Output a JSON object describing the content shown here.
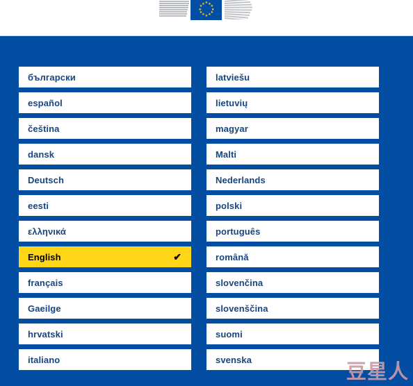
{
  "header": {
    "logo_name": "european-commission-logo",
    "flag_alt": "European Union flag",
    "star_glyph": "★"
  },
  "colors": {
    "panel_blue": "#034ea2",
    "selected_yellow": "#ffd617",
    "item_background": "#ffffff",
    "item_text": "#17457f",
    "selected_text": "#000000",
    "watermark": "#c89ba6"
  },
  "language_selector": {
    "selected_language": "English",
    "check_glyph": "✔",
    "columns": [
      {
        "items": [
          {
            "label": "български",
            "selected": false
          },
          {
            "label": "español",
            "selected": false
          },
          {
            "label": "čeština",
            "selected": false
          },
          {
            "label": "dansk",
            "selected": false
          },
          {
            "label": "Deutsch",
            "selected": false
          },
          {
            "label": "eesti",
            "selected": false
          },
          {
            "label": "ελληνικά",
            "selected": false
          },
          {
            "label": "English",
            "selected": true
          },
          {
            "label": "français",
            "selected": false
          },
          {
            "label": "Gaeilge",
            "selected": false
          },
          {
            "label": "hrvatski",
            "selected": false
          },
          {
            "label": "italiano",
            "selected": false
          }
        ]
      },
      {
        "items": [
          {
            "label": "latviešu",
            "selected": false
          },
          {
            "label": "lietuvių",
            "selected": false
          },
          {
            "label": "magyar",
            "selected": false
          },
          {
            "label": "Malti",
            "selected": false
          },
          {
            "label": "Nederlands",
            "selected": false
          },
          {
            "label": "polski",
            "selected": false
          },
          {
            "label": "português",
            "selected": false
          },
          {
            "label": "română",
            "selected": false
          },
          {
            "label": "slovenčina",
            "selected": false
          },
          {
            "label": "slovenščina",
            "selected": false
          },
          {
            "label": "suomi",
            "selected": false
          },
          {
            "label": "svenska",
            "selected": false
          }
        ]
      }
    ]
  },
  "watermark": {
    "text": "豆星人"
  }
}
